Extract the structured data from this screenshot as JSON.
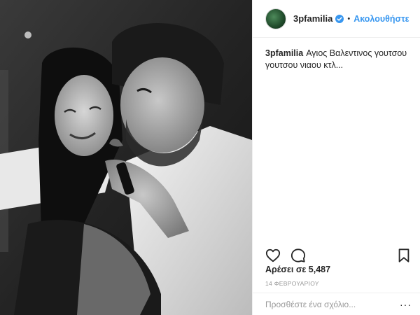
{
  "post": {
    "username": "3pfamilia",
    "verified": true,
    "separator": "•",
    "follow_label": "Ακολουθήστε",
    "caption_user": "3pfamilia",
    "caption_text": "Αγιος Βαλεντινος γουτσου γουτσου νιαου κτλ...",
    "likes_text": "Αρέσει σε 5,487",
    "date_text": "14 ΦΕΒΡΟΥΑΡΙΟΥ",
    "comment_placeholder": "Προσθέστε ένα σχόλιο...",
    "more_label": "···"
  },
  "icons": {
    "avatar": "profile-avatar",
    "verified": "verified-badge-icon",
    "like": "heart-icon",
    "comment": "comment-bubble-icon",
    "save": "bookmark-icon",
    "more": "more-options-icon"
  },
  "colors": {
    "link": "#3897f0",
    "text": "#262626",
    "muted": "#999999",
    "border": "#efefef"
  },
  "photo": {
    "description_name": "black-and-white couple selfie",
    "tone": "monochrome"
  }
}
